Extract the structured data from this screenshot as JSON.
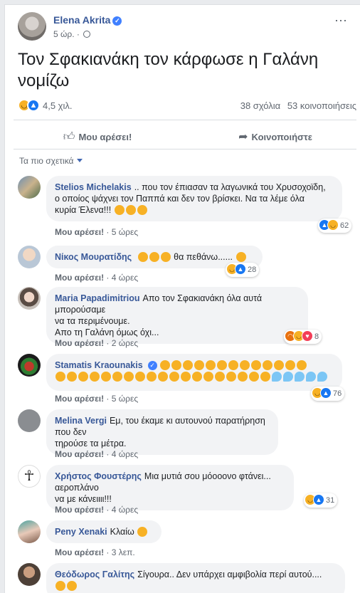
{
  "post": {
    "author": "Elena Akrita",
    "time": "5 ώρ. ·",
    "text": "Τον Σφακιανάκη τον κάρφωσε η Γαλάνη νομίζω",
    "reactions_count": "4,5 χιλ.",
    "comments_count": "38 σχόλια",
    "shares_count": "53 κοινοποιήσεις",
    "more_icon": "⋯"
  },
  "actions": {
    "like_label": "Μου αρέσει!",
    "share_label": "Κοινοποιήστε"
  },
  "sort_label": "Τα πιο σχετικά",
  "comment_like_label": "Μου αρέσει!",
  "comments": [
    {
      "name": "Stelios Michelakis",
      "text_lines": [
        ".. που τον έπιασαν τα λαγωνικά του Χρυσοχοϊδη,",
        "ο οποίος ψάχνει τον Παππά και δεν τον βρίσκει. Να τα λέμε όλα",
        "κυρία Έλενα!!!"
      ],
      "time": "5 ώρες",
      "reactions": "62"
    },
    {
      "name": "Νίκος Μουρατίδης",
      "text_lines": [
        "θα πεθάνω......"
      ],
      "time": "4 ώρες",
      "reactions": "28"
    },
    {
      "name": "Maria Papadimitriou",
      "text_lines": [
        "Απο τον Σφακιανάκη όλα αυτά μπορούσαμε",
        "να τα περιμένουμε.",
        "Απο τη Γαλάνη όμως όχι..."
      ],
      "time": "2 ώρες",
      "reactions": "8"
    },
    {
      "name": "Stamatis Kraounakis",
      "text_lines": [
        ""
      ],
      "time": "5 ώρες",
      "reactions": "76"
    },
    {
      "name": "Melina Vergi",
      "text_lines": [
        "Εμ, του έκαμε κι αυτουνού παρατήρηση που δεν",
        "τηρούσε τα μέτρα."
      ],
      "time": "4 ώρες",
      "reactions": ""
    },
    {
      "name": "Χρήστος Φουστέρης",
      "text_lines": [
        "Μια μυτιά σου μόοοονο φτάνει... αεροπλάνο",
        "να με κάνειιιι!!!"
      ],
      "time": "4 ώρες",
      "reactions": "31"
    },
    {
      "name": "Peny Xenaki",
      "text_lines": [
        "Κλαίω"
      ],
      "time": "3 λεπ.",
      "reactions": ""
    },
    {
      "name": "Θεόδωρος Γαλίτης",
      "text_lines": [
        "Σίγουρα.. Δεν υπάρχει αμφιβολία περί αυτού...."
      ],
      "time": "",
      "reactions": ""
    }
  ],
  "colors": {
    "link": "#385898",
    "bubble": "#f2f3f5",
    "haha": "#f7b125",
    "like": "#1877f2"
  }
}
